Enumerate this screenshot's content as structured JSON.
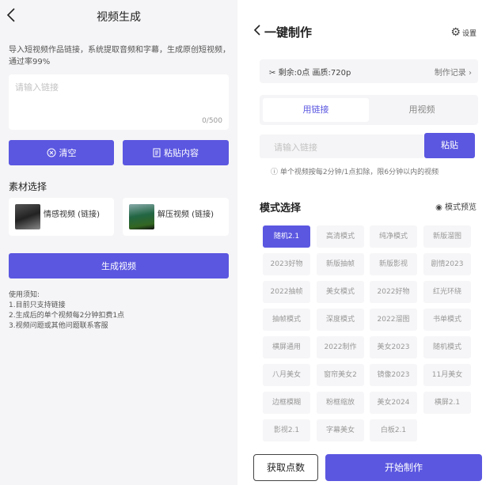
{
  "left": {
    "title": "视频生成",
    "back_icon": "chevron-left-icon",
    "description": "导入短视频作品链接，系统提取音频和字幕，生成原创短视频，通过率99%",
    "textarea_placeholder": "请输入链接",
    "char_count": "0/500",
    "clear_label": "清空",
    "paste_label": "粘贴内容",
    "material_title": "素材选择",
    "materials": [
      {
        "label": "情感视频 (链接)"
      },
      {
        "label": "解压视频 (链接)"
      }
    ],
    "generate_label": "生成视频",
    "notes": [
      "使用须知:",
      "1.目前只支持链接",
      "2.生成后的单个视频每2分钟扣费1点",
      "3.视频问题或其他问题联系客服"
    ]
  },
  "right": {
    "title": "一键制作",
    "settings_label": "设置",
    "status": "剩余:0点 画质:720p",
    "records_label": "制作记录",
    "tabs": [
      "用链接",
      "用视频"
    ],
    "link_placeholder": "请输入链接",
    "paste_label": "粘贴",
    "hint": "单个视频按每2分钟/1点扣除，限6分钟以内的视频",
    "mode_title": "模式选择",
    "preview_label": "模式预览",
    "modes": [
      "随机2.1",
      "高清模式",
      "纯净模式",
      "新版溜图",
      "2023好物",
      "新版抽帧",
      "新版影视",
      "剧情2023",
      "2022抽帧",
      "美女模式",
      "2022好物",
      "红光环绕",
      "抽帧模式",
      "深度模式",
      "2022溜图",
      "书单模式",
      "横屏通用",
      "2022制作",
      "美女2023",
      "随机模式",
      "八月美女",
      "窗帘美女2",
      "镜像2023",
      "11月美女",
      "边框模糊",
      "粉框缩放",
      "美女2024",
      "横屏2.1",
      "影视2.1",
      "字幕美女",
      "白板2.1"
    ],
    "active_mode": 0,
    "points_label": "获取点数",
    "start_label": "开始制作"
  },
  "colors": {
    "accent": "#5b57e0"
  }
}
